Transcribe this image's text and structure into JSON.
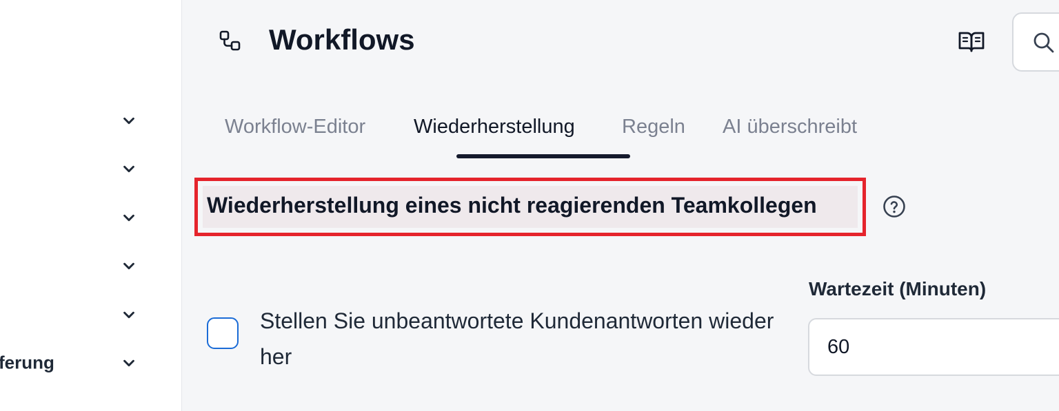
{
  "sidebar": {
    "items": [
      {
        "label": "",
        "icon": "chevron-down-icon"
      },
      {
        "label": "",
        "icon": "chevron-down-icon"
      },
      {
        "label": "",
        "icon": "chevron-down-icon"
      },
      {
        "label": "",
        "icon": "chevron-down-icon"
      },
      {
        "label": "",
        "icon": "chevron-down-icon"
      },
      {
        "label": "ferung",
        "icon": "chevron-down-icon"
      }
    ]
  },
  "header": {
    "icon": "workflow-icon",
    "title": "Workflows",
    "docs_icon": "book-open-icon",
    "search_icon": "search-icon"
  },
  "tabs": [
    {
      "label": "Workflow-Editor",
      "active": false
    },
    {
      "label": "Wiederherstellung",
      "active": true
    },
    {
      "label": "Regeln",
      "active": false
    },
    {
      "label": "AI überschreibt",
      "active": false
    }
  ],
  "section": {
    "heading": "Wiederherstellung eines nicht reagierenden Teamkollegen",
    "help_icon": "help-circle-icon",
    "highlight_color": "#e5242c"
  },
  "restore_option": {
    "checked": false,
    "label": "Stellen Sie unbeantwortete Kundenantworten wieder her"
  },
  "wait_time": {
    "label": "Wartezeit (Minuten)",
    "value": "60"
  },
  "colors": {
    "accent": "#1a6bd6",
    "active_tab_underline": "#151a2d",
    "inactive_tab_text": "#7b8190"
  }
}
